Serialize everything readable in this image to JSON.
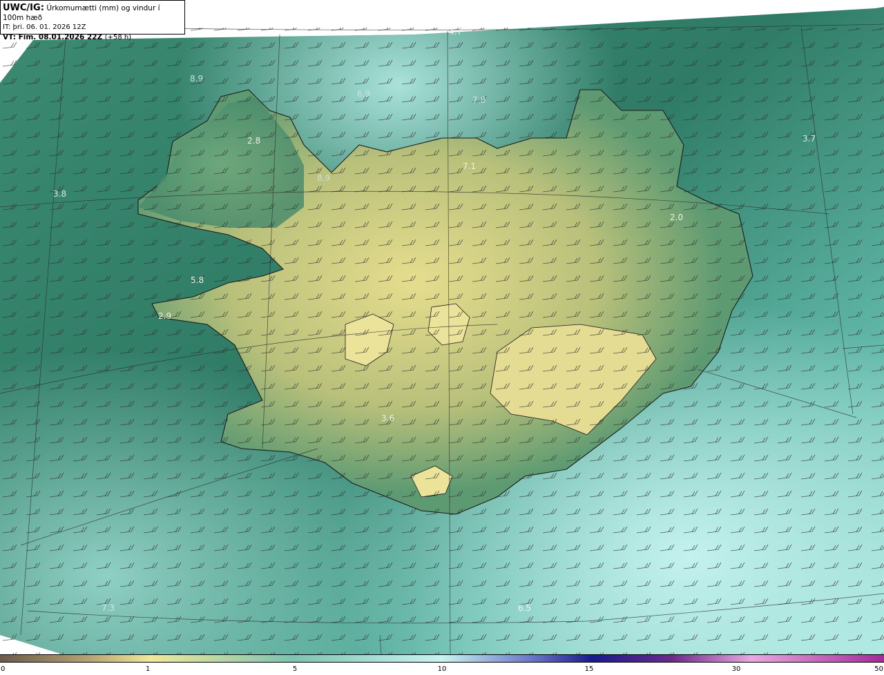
{
  "header": {
    "code": "UWC/IG:",
    "title": "Úrkomumætti (mm) og vindur í 100m hæð",
    "issue_time": "IT: þri. 06. 01. 2026 12Z",
    "valid_label": "VT: Fim. 08.01.2026 22Z",
    "valid_offset": "(+58 h)"
  },
  "map_labels": [
    {
      "id": "l1",
      "text": "4.7"
    },
    {
      "id": "l2",
      "text": "8.9"
    },
    {
      "id": "l3",
      "text": "6.9"
    },
    {
      "id": "l4",
      "text": "7.8"
    },
    {
      "id": "l5",
      "text": "2.8"
    },
    {
      "id": "l6",
      "text": "3.7"
    },
    {
      "id": "l7",
      "text": "7.1"
    },
    {
      "id": "l8",
      "text": "8.9"
    },
    {
      "id": "l9",
      "text": "3.8"
    },
    {
      "id": "l10",
      "text": "2.0"
    },
    {
      "id": "l11",
      "text": "5.8"
    },
    {
      "id": "l12",
      "text": "2.9"
    },
    {
      "id": "l13",
      "text": "3.6"
    },
    {
      "id": "l14",
      "text": "7.3"
    },
    {
      "id": "l15",
      "text": "6.5"
    }
  ],
  "colorbar": {
    "ticks": [
      "0",
      "1",
      "5",
      "10",
      "15",
      "30",
      "50"
    ],
    "colors": [
      "#6b5a4a",
      "#b6a272",
      "#f1e89a",
      "#7fc2b0",
      "#c8f4f0",
      "#6c78c8",
      "#1a1a90",
      "#6a2a88",
      "#e8a8e0",
      "#a42a9a"
    ]
  },
  "colors": {
    "sea_dark": "#2f7a64",
    "sea_light": "#9fe0da",
    "land_yellow": "#dfd98a",
    "land_green": "#3f8a6a"
  }
}
